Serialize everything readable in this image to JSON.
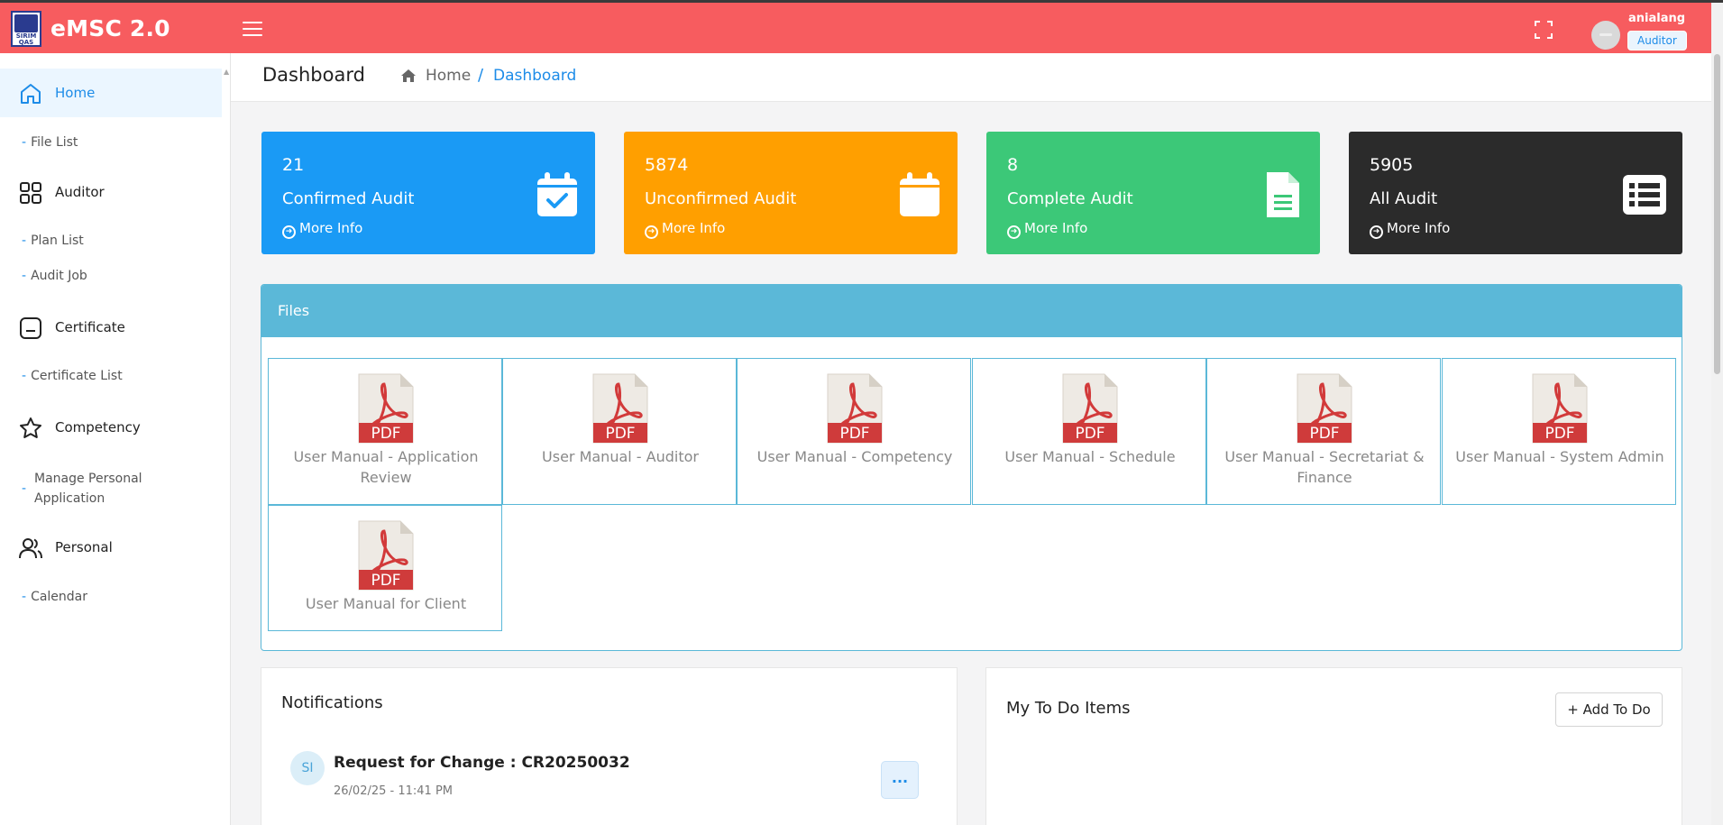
{
  "app": {
    "title": "eMSC 2.0",
    "logo_text_top": "SIRIM",
    "logo_text_bottom": "QAS"
  },
  "user": {
    "name": "anialang",
    "role": "Auditor"
  },
  "sidebar": {
    "items": [
      {
        "label": "Home",
        "icon": "home-icon",
        "type": "main",
        "active": true
      },
      {
        "label": "File List",
        "type": "sub"
      },
      {
        "label": "Auditor",
        "icon": "grid-icon",
        "type": "main"
      },
      {
        "label": "Plan List",
        "type": "sub"
      },
      {
        "label": "Audit Job",
        "type": "sub"
      },
      {
        "label": "Certificate",
        "icon": "certificate-icon",
        "type": "main"
      },
      {
        "label": "Certificate List",
        "type": "sub"
      },
      {
        "label": "Competency",
        "icon": "star-icon",
        "type": "main"
      },
      {
        "label": "Manage Personal Application",
        "type": "sub"
      },
      {
        "label": "Personal",
        "icon": "users-icon",
        "type": "main"
      },
      {
        "label": "Calendar",
        "type": "sub"
      }
    ]
  },
  "header": {
    "title": "Dashboard",
    "breadcrumb": {
      "home": "Home",
      "separator": "/",
      "current": "Dashboard"
    }
  },
  "cards": [
    {
      "value": "21",
      "label": "Confirmed Audit",
      "more": "More Info",
      "color": "#1a9af5",
      "icon": "calendar-check-icon"
    },
    {
      "value": "5874",
      "label": "Unconfirmed Audit",
      "more": "More Info",
      "color": "#ff9f00",
      "icon": "calendar-icon"
    },
    {
      "value": "8",
      "label": "Complete Audit",
      "more": "More Info",
      "color": "#3cc878",
      "icon": "document-icon"
    },
    {
      "value": "5905",
      "label": "All Audit",
      "more": "More Info",
      "color": "#2b2b2b",
      "icon": "list-icon"
    }
  ],
  "files": {
    "title": "Files",
    "pdf_label": "PDF",
    "items": [
      "User Manual - Application Review",
      "User Manual - Auditor",
      "User Manual - Competency",
      "User Manual - Schedule",
      "User Manual - Secretariat & Finance",
      "User Manual - System Admin",
      "User Manual for Client"
    ]
  },
  "notifications": {
    "title": "Notifications",
    "items": [
      {
        "initials": "SI",
        "title": "Request for Change : CR20250032",
        "time": "26/02/25 - 11:41 PM",
        "more": "..."
      }
    ]
  },
  "todo": {
    "title": "My To Do Items",
    "add_label": "+ Add To Do"
  },
  "colors": {
    "topbar": "#f75c5f",
    "accent": "#1d8ce8",
    "files_header": "#5bb8d8"
  }
}
